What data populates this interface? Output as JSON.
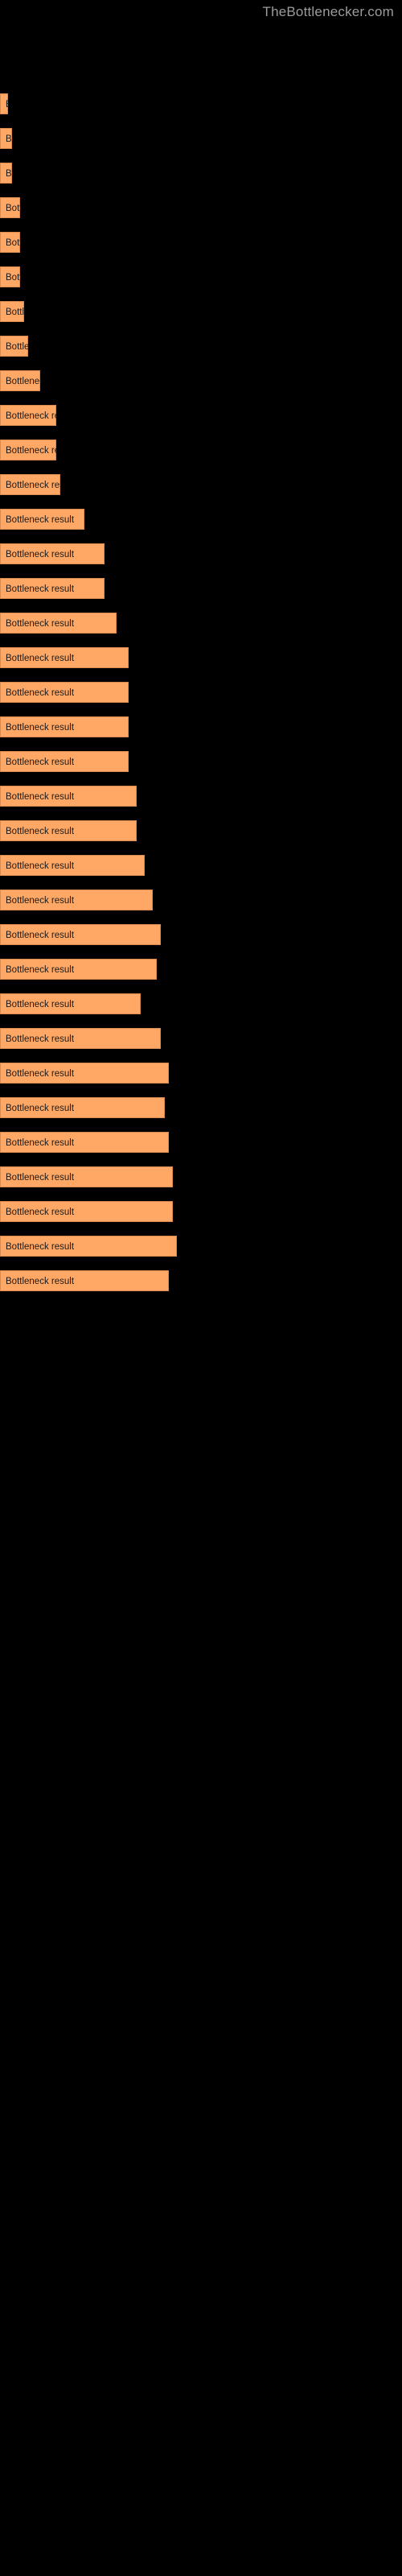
{
  "watermark": "TheBottlenecker.com",
  "chart_data": {
    "type": "bar",
    "orientation": "horizontal",
    "title": "",
    "subtitle": "",
    "xlabel": "",
    "ylabel": "",
    "grid": false,
    "legend": null,
    "background": "#000000",
    "bar_color": "#ffa866",
    "bar_edge_color": "#d98a4e",
    "label_color": "#1a1a1a",
    "xlim": [
      0,
      100
    ],
    "categories": [
      "",
      "",
      "",
      "",
      "",
      "",
      "",
      "",
      "",
      "",
      "",
      "",
      "",
      "",
      "",
      "",
      "",
      "",
      "",
      "",
      "",
      "",
      "",
      "",
      "",
      "",
      "",
      "",
      "",
      "",
      "",
      "",
      "",
      "",
      "",
      "",
      "",
      ""
    ],
    "bars": [
      {
        "label": "Bottleneck result",
        "value": 2,
        "y": 116
      },
      {
        "label": "Bottleneck result",
        "value": 3,
        "y": 159
      },
      {
        "label": "Bottleneck result",
        "value": 3,
        "y": 202
      },
      {
        "label": "Bottleneck result",
        "value": 5,
        "y": 245
      },
      {
        "label": "Bottleneck result",
        "value": 5,
        "y": 288
      },
      {
        "label": "Bottleneck result",
        "value": 5,
        "y": 331
      },
      {
        "label": "Bottleneck result",
        "value": 6,
        "y": 374
      },
      {
        "label": "Bottleneck result",
        "value": 7,
        "y": 417
      },
      {
        "label": "Bottleneck result",
        "value": 10,
        "y": 460
      },
      {
        "label": "Bottleneck result",
        "value": 14,
        "y": 503
      },
      {
        "label": "Bottleneck result",
        "value": 14,
        "y": 546
      },
      {
        "label": "Bottleneck result",
        "value": 15,
        "y": 589
      },
      {
        "label": "Bottleneck result",
        "value": 21,
        "y": 632
      },
      {
        "label": "Bottleneck result",
        "value": 26,
        "y": 675
      },
      {
        "label": "Bottleneck result",
        "value": 26,
        "y": 718
      },
      {
        "label": "Bottleneck result",
        "value": 29,
        "y": 761
      },
      {
        "label": "Bottleneck result",
        "value": 32,
        "y": 804
      },
      {
        "label": "Bottleneck result",
        "value": 32,
        "y": 847
      },
      {
        "label": "Bottleneck result",
        "value": 32,
        "y": 890
      },
      {
        "label": "Bottleneck result",
        "value": 32,
        "y": 933
      },
      {
        "label": "Bottleneck result",
        "value": 34,
        "y": 976
      },
      {
        "label": "Bottleneck result",
        "value": 34,
        "y": 1019
      },
      {
        "label": "Bottleneck result",
        "value": 36,
        "y": 1062
      },
      {
        "label": "Bottleneck result",
        "value": 38,
        "y": 1105
      },
      {
        "label": "Bottleneck result",
        "value": 40,
        "y": 1148
      },
      {
        "label": "Bottleneck result",
        "value": 39,
        "y": 1191
      },
      {
        "label": "Bottleneck result",
        "value": 35,
        "y": 1234
      },
      {
        "label": "Bottleneck result",
        "value": 40,
        "y": 1277
      },
      {
        "label": "Bottleneck result",
        "value": 42,
        "y": 1320
      },
      {
        "label": "Bottleneck result",
        "value": 41,
        "y": 1363
      },
      {
        "label": "Bottleneck result",
        "value": 42,
        "y": 1406
      },
      {
        "label": "Bottleneck result",
        "value": 43,
        "y": 1449
      },
      {
        "label": "Bottleneck result",
        "value": 43,
        "y": 1492
      },
      {
        "label": "Bottleneck result",
        "value": 44,
        "y": 1535
      },
      {
        "label": "Bottleneck result",
        "value": 42,
        "y": 1578
      }
    ]
  }
}
